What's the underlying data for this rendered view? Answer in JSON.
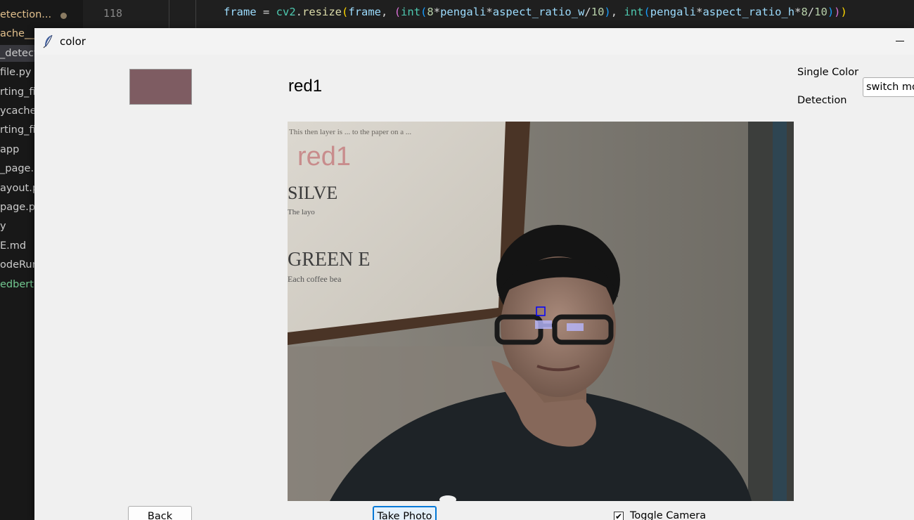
{
  "vscode": {
    "explorer_items": [
      {
        "label": "etection...",
        "state": "modified"
      },
      {
        "label": "ache__",
        "state": "modified"
      },
      {
        "label": "_detect",
        "state": "selected"
      },
      {
        "label": "file.py",
        "state": "normal"
      },
      {
        "label": "rting_fi",
        "state": "normal"
      },
      {
        "label": "ycache",
        "state": "normal"
      },
      {
        "label": "rting_fi",
        "state": "normal"
      },
      {
        "label": "app",
        "state": "normal"
      },
      {
        "label": "_page.p",
        "state": "normal"
      },
      {
        "label": "ayout.p",
        "state": "normal"
      },
      {
        "label": "page.py",
        "state": "normal"
      },
      {
        "label": "y",
        "state": "normal"
      },
      {
        "label": "E.md",
        "state": "normal"
      },
      {
        "label": "odeRun",
        "state": "normal"
      },
      {
        "label": "edbert",
        "state": "untracked"
      }
    ],
    "line_number": "118",
    "code": {
      "t1": "frame",
      "t2": " = ",
      "t3": "cv2",
      "t4": ".",
      "t5": "resize",
      "t6": "(",
      "t7": "frame",
      "t8": ", ",
      "t9": "(",
      "t10": "int",
      "t11": "(",
      "t12": "8",
      "t13": "*",
      "t14": "pengali",
      "t15": "*",
      "t16": "aspect_ratio_w",
      "t17": "/",
      "t18": "10",
      "t19": ")",
      "t20": ", ",
      "t21": "int",
      "t22": "(",
      "t23": "pengali",
      "t24": "*",
      "t25": "aspect_ratio_h",
      "t26": "*",
      "t27": "8",
      "t28": "/",
      "t29": "10",
      "t30": ")",
      "t31": ")",
      "t32": ")"
    }
  },
  "window": {
    "title": "color",
    "icon": "feather-icon",
    "minimize_icon": "minimize-icon"
  },
  "app": {
    "swatch_color": "#7e5c62",
    "color_name": "red1",
    "side_label_1": "Single Color",
    "side_label_2": "Detection",
    "mode_button": "switch mode",
    "camera": {
      "overlay_text_top": "This then layer is ... to the paper on a ...",
      "overlay_name": "red1",
      "overlay_brand": "SILVE",
      "overlay_small": "The layo",
      "overlay_green": "GREEN E",
      "overlay_coffee": "Each coffee bea"
    },
    "back_button": "Back",
    "take_photo_button": "Take Photo",
    "toggle_camera_label": "Toggle Camera",
    "toggle_camera_checked": true,
    "checkmark": "✔"
  }
}
